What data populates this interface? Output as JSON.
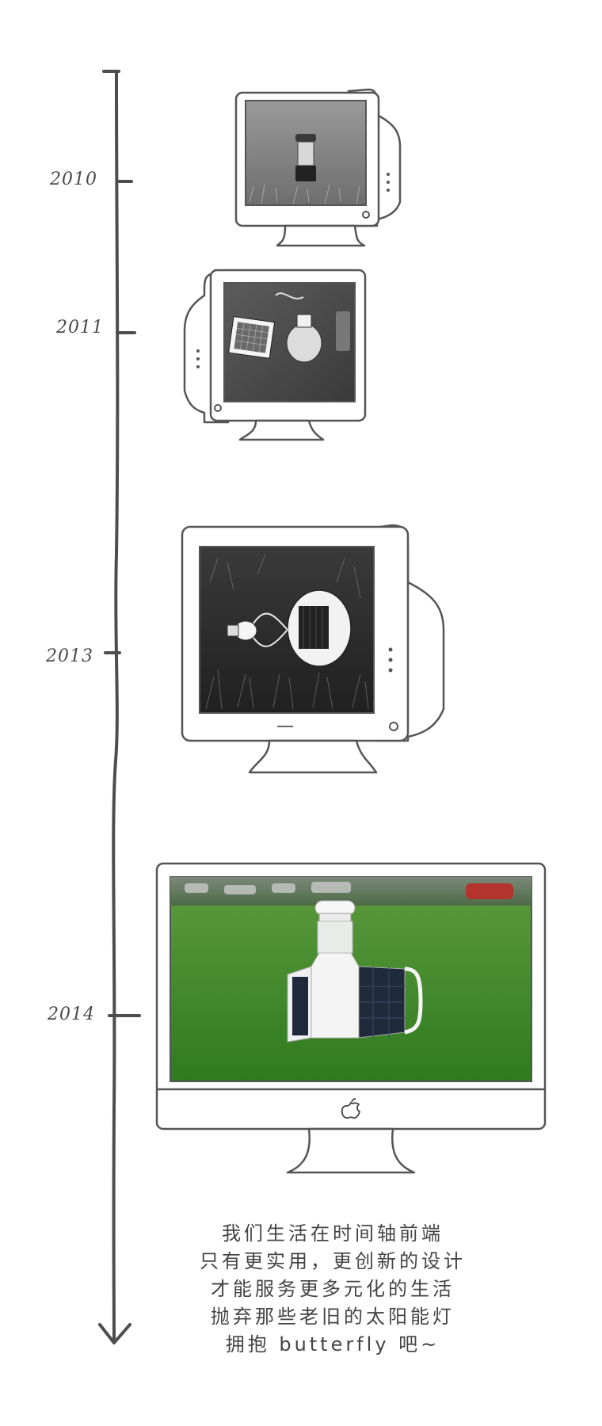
{
  "timeline": {
    "years": [
      "2010",
      "2011",
      "2013",
      "2014"
    ]
  },
  "monitors": [
    {
      "kind": "crt-right",
      "image": "solar-lantern-on-grass"
    },
    {
      "kind": "crt-left",
      "image": "solar-panel-and-bulb-kit"
    },
    {
      "kind": "crt-right",
      "image": "round-solar-lamp-on-grass"
    },
    {
      "kind": "imac",
      "image": "butterfly-solar-lamp-on-lawn"
    }
  ],
  "imac_logo": "apple-icon",
  "caption": {
    "lines": [
      "我们生活在时间轴前端",
      "只有更实用，更创新的设计",
      "才能服务更多元化的生活",
      "抛弃那些老旧的太阳能灯",
      "拥抱 butterfly 吧~"
    ]
  },
  "colors": {
    "ink": "#4a4a4a",
    "background": "#ffffff",
    "grass": "#3f8f2a"
  }
}
